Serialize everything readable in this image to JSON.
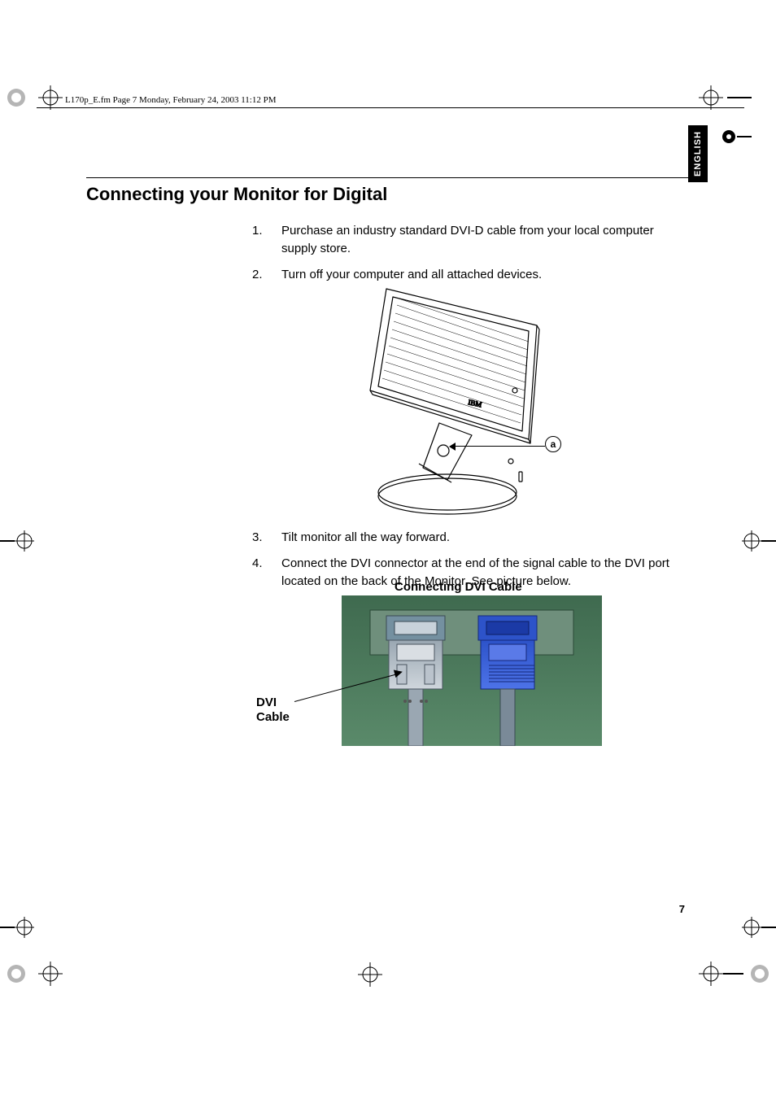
{
  "header": {
    "text": "L170p_E.fm  Page 7  Monday, February 24, 2003  11:12 PM"
  },
  "language_tab": "ENGLISH",
  "section": {
    "title": "Connecting your Monitor for Digital"
  },
  "steps_top": [
    {
      "n": "1.",
      "t": "Purchase an industry standard DVI-D cable from your local computer supply store."
    },
    {
      "n": "2.",
      "t": "Turn off your computer and all attached devices."
    }
  ],
  "callout_a": "a",
  "steps_bottom": [
    {
      "n": "3.",
      "t": "Tilt monitor all the way forward."
    },
    {
      "n": "4.",
      "t": "Connect the DVI connector at the end of the signal cable to the DVI port located on the back of the Monitor. See picture below."
    }
  ],
  "fig2_caption": "Connecting DVI Cable",
  "dvi_label_l1": "DVI",
  "dvi_label_l2": "Cable",
  "page_number": "7"
}
